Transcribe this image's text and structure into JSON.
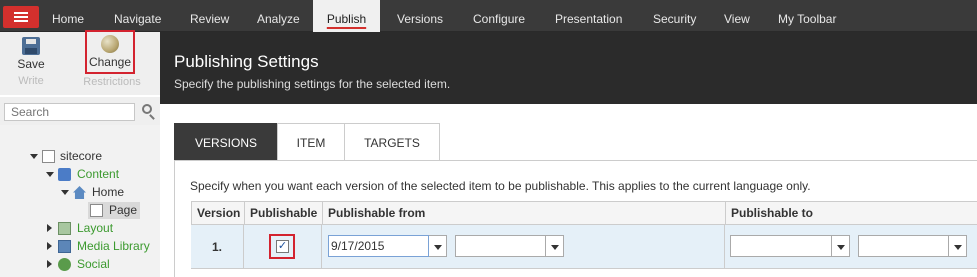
{
  "top_tabs": {
    "home": "Home",
    "navigate": "Navigate",
    "review": "Review",
    "analyze": "Analyze",
    "publish": "Publish",
    "versions": "Versions",
    "configure": "Configure",
    "presentation": "Presentation",
    "security": "Security",
    "view": "View",
    "my_toolbar": "My Toolbar"
  },
  "ribbon": {
    "save_label": "Save",
    "write_group": "Write",
    "change_label": "Change",
    "restrictions_group": "Restrictions"
  },
  "search": {
    "placeholder": "Search"
  },
  "tree": {
    "sitecore": "sitecore",
    "content": "Content",
    "home": "Home",
    "page": "Page",
    "layout": "Layout",
    "media_library": "Media Library",
    "social": "Social"
  },
  "dialog": {
    "title": "Publishing Settings",
    "subtitle": "Specify the publishing settings for the selected item."
  },
  "tabs": {
    "versions": "VERSIONS",
    "item": "ITEM",
    "targets": "TARGETS"
  },
  "versions_panel": {
    "description": "Specify when you want each version of the selected item to be publishable. This applies to the current language only.",
    "columns": {
      "version": "Version",
      "publishable": "Publishable",
      "publishable_from": "Publishable from",
      "publishable_to": "Publishable to"
    },
    "row": {
      "version": "1.",
      "publishable_checked": true,
      "checkmark": "✓",
      "from_date": "9/17/2015",
      "from_time": "",
      "to_date": "",
      "to_time": ""
    }
  },
  "colors": {
    "accent": "#d3302d",
    "header_dark": "#2b2b2b",
    "row_highlight": "#e5f0f8"
  }
}
